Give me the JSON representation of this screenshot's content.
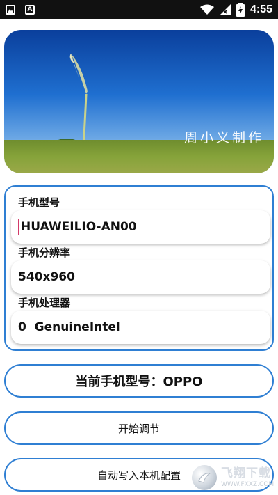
{
  "statusbar": {
    "time": "4:55",
    "left_icons": [
      "gallery-icon",
      "font-icon"
    ],
    "right_icons": [
      "wifi-icon",
      "signal-icon",
      "battery-icon"
    ]
  },
  "banner": {
    "signature": "周小义制作"
  },
  "form": {
    "model_label": "手机型号",
    "model_value": "HUAWEILIO-AN00",
    "resolution_label": "手机分辨率",
    "resolution_value": "540x960",
    "processor_label": "手机处理器",
    "processor_value": "0  GenuineIntel"
  },
  "current_model": "当前手机型号：OPPO",
  "buttons": {
    "start": "开始调节",
    "auto_write": "自动写入本机配置"
  },
  "watermark": {
    "name": "飞翔下载",
    "url": "WWW.FXXZ.COM"
  },
  "colors": {
    "accent": "#2f7fd3",
    "statusbar": "#111111"
  }
}
